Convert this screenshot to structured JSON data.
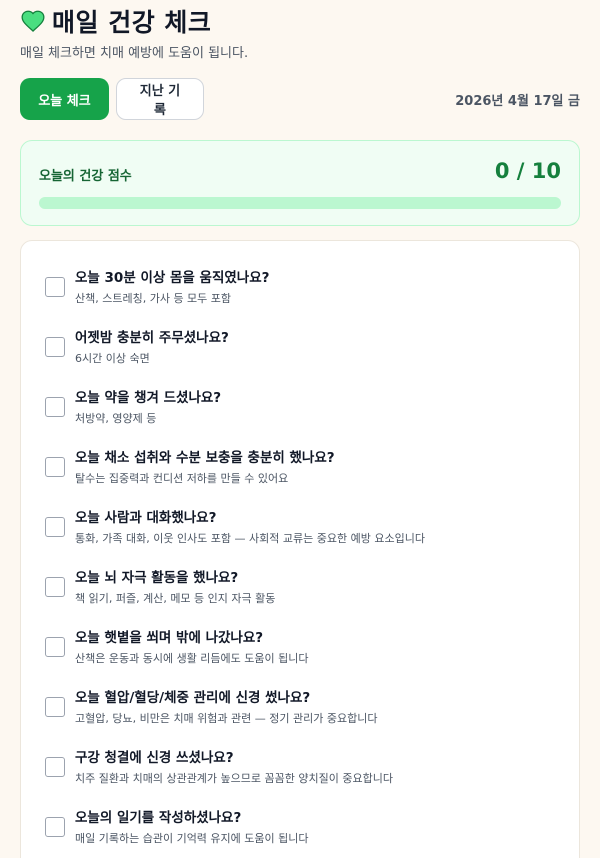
{
  "header": {
    "title": "매일 건강 체크",
    "subtitle": "매일 체크하면 치매 예방에 도움이 됩니다."
  },
  "toolbar": {
    "today_label": "오늘 체크",
    "history_label": "지난 기록",
    "date": "2026년 4월 17일 금"
  },
  "score": {
    "label": "오늘의 건강 점수",
    "value_text": "0 / 10",
    "progress_fraction": 0
  },
  "checklist": [
    {
      "title": "오늘 30분 이상 몸을 움직였나요?",
      "desc": "산책, 스트레칭, 가사 등 모두 포함",
      "checked": false
    },
    {
      "title": "어젯밤 충분히 주무셨나요?",
      "desc": "6시간 이상 숙면",
      "checked": false
    },
    {
      "title": "오늘 약을 챙겨 드셨나요?",
      "desc": "처방약, 영양제 등",
      "checked": false
    },
    {
      "title": "오늘 채소 섭취와 수분 보충을 충분히 했나요?",
      "desc": "탈수는 집중력과 컨디션 저하를 만들 수 있어요",
      "checked": false
    },
    {
      "title": "오늘 사람과 대화했나요?",
      "desc": "통화, 가족 대화, 이웃 인사도 포함 — 사회적 교류는 중요한 예방 요소입니다",
      "checked": false
    },
    {
      "title": "오늘 뇌 자극 활동을 했나요?",
      "desc": "책 읽기, 퍼즐, 계산, 메모 등 인지 자극 활동",
      "checked": false
    },
    {
      "title": "오늘 햇볕을 쐬며 밖에 나갔나요?",
      "desc": "산책은 운동과 동시에 생활 리듬에도 도움이 됩니다",
      "checked": false
    },
    {
      "title": "오늘 혈압/혈당/체중 관리에 신경 썼나요?",
      "desc": "고혈압, 당뇨, 비만은 치매 위험과 관련 — 정기 관리가 중요합니다",
      "checked": false
    },
    {
      "title": "구강 청결에 신경 쓰셨나요?",
      "desc": "치주 질환과 치매의 상관관계가 높으므로 꼼꼼한 양치질이 중요합니다",
      "checked": false
    },
    {
      "title": "오늘의 일기를 작성하셨나요?",
      "desc": "매일 기록하는 습관이 기억력 유지에 도움이 됩니다",
      "checked": false
    }
  ],
  "icons": {
    "heart": "green-heart-icon"
  },
  "colors": {
    "accent": "#16a34a",
    "score_bg": "#f0fdf4",
    "page_bg": "#fdf8f1"
  }
}
